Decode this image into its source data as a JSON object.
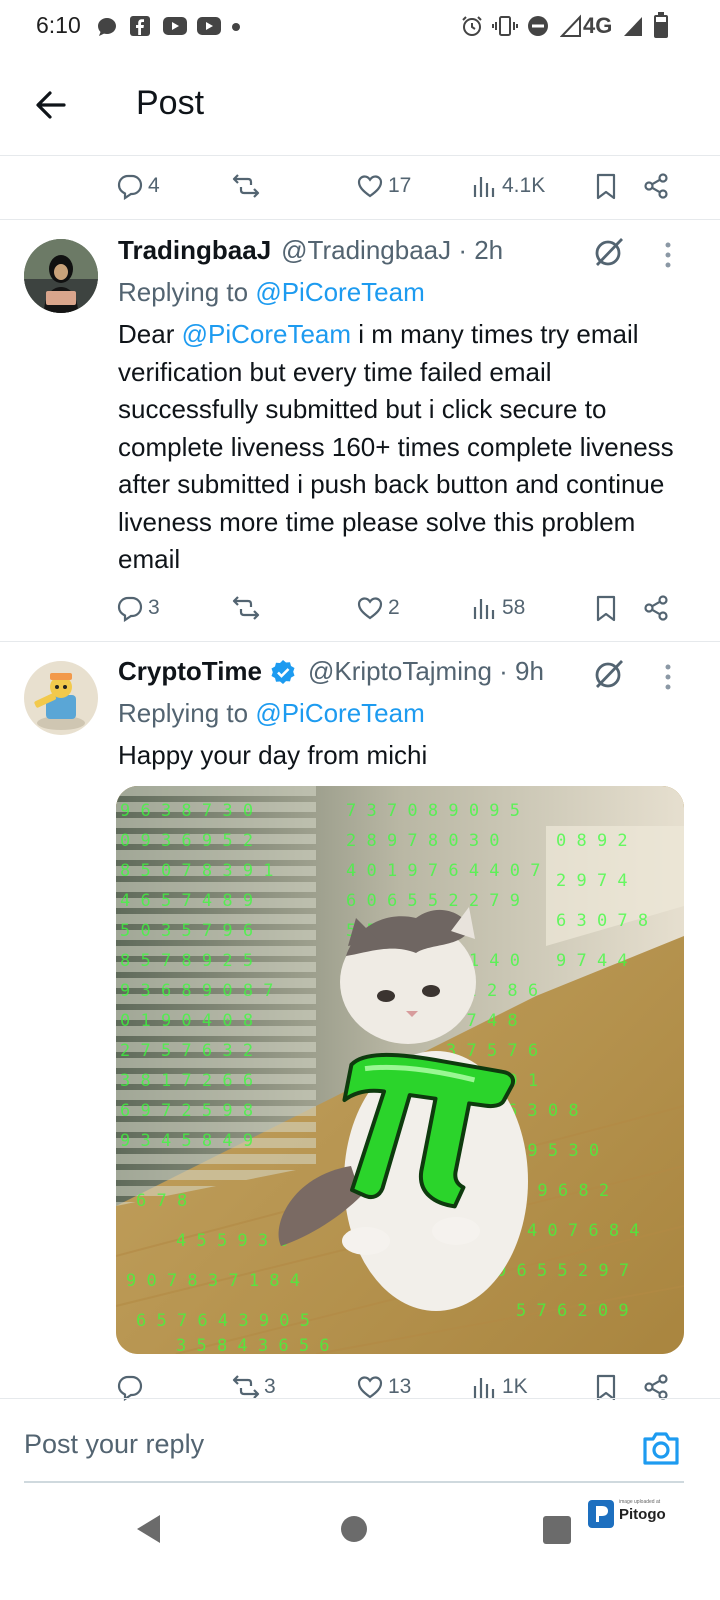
{
  "status_bar": {
    "time": "6:10",
    "network": "4G"
  },
  "header": {
    "title": "Post"
  },
  "top_actions": {
    "replies": "4",
    "reposts": "",
    "likes": "17",
    "views": "4.1K"
  },
  "tweets": [
    {
      "name": "TradingbaaJ",
      "handle": "@TradingbaaJ · 2h",
      "replying_prefix": "Replying to",
      "replying_to": "@PiCoreTeam",
      "body_prefix": "Dear",
      "body_mention": "@PiCoreTeam",
      "body_text": " i m many times try email verification but every time failed email successfully submitted but i click secure to complete liveness 160+ times complete liveness after submitted i push back button and continue liveness more time please solve this problem email",
      "actions": {
        "replies": "3",
        "reposts": "",
        "likes": "2",
        "views": "58"
      }
    },
    {
      "name": "CryptoTime",
      "handle": "@KriptoTajming · 9h",
      "verified": true,
      "replying_prefix": "Replying to",
      "replying_to": "@PiCoreTeam",
      "body_text": "Happy your day from michi",
      "actions": {
        "replies": "",
        "reposts": "3",
        "likes": "13",
        "views": "1K"
      }
    }
  ],
  "reply_bar": {
    "placeholder": "Post your reply"
  },
  "watermark": {
    "text": "Pitogo",
    "small": "image uploaded at"
  },
  "colors": {
    "accent": "#1d9bf0",
    "secondary_text": "#536471",
    "verified": "#1d9bf0"
  },
  "icons": [
    "back-arrow-icon",
    "reply-icon",
    "repost-icon",
    "like-icon",
    "views-icon",
    "bookmark-icon",
    "share-icon",
    "grok-icon",
    "more-icon",
    "verified-badge-icon",
    "camera-icon",
    "nav-back-icon",
    "nav-home-icon",
    "nav-recents-icon"
  ]
}
